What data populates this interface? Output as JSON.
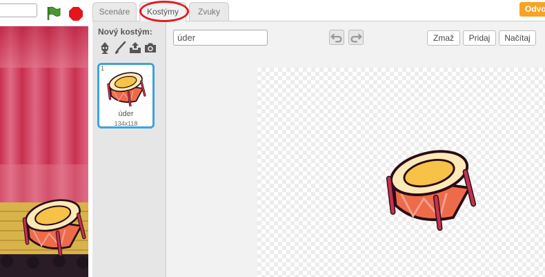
{
  "tabs": {
    "scenes": "Scenáre",
    "costumes": "Kostýmy",
    "sounds": "Zvuky"
  },
  "header": {
    "orange_button": "Odvo"
  },
  "costume_pane": {
    "new_costume_label": "Nový kostým:",
    "icons": [
      "sprite-library-icon",
      "paint-brush-icon",
      "upload-icon",
      "camera-icon"
    ],
    "costumes": [
      {
        "number": "1",
        "name": "úder",
        "size": "134x118"
      }
    ]
  },
  "editor": {
    "costume_name": "úder",
    "buttons": {
      "clear": "Zmaž",
      "add": "Pridaj",
      "import": "Načítaj"
    }
  },
  "colors": {
    "selection": "#3da3dc",
    "highlight": "#e01b24",
    "accent": "#f7a324",
    "flag": "#4a9a2f",
    "stop": "#e8141c"
  }
}
